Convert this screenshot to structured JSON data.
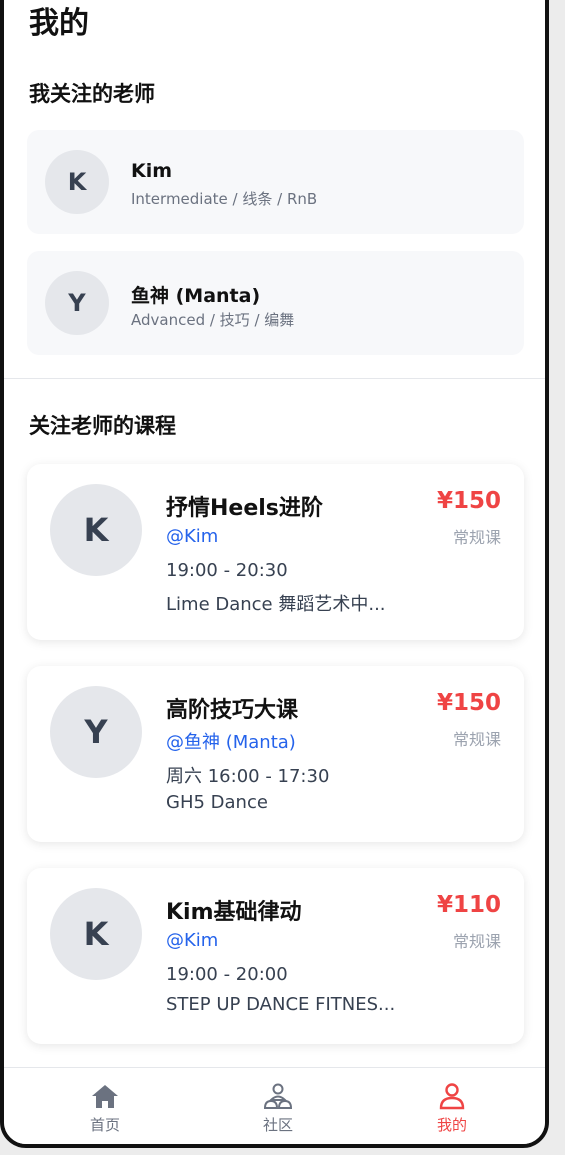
{
  "page": {
    "title": "我的"
  },
  "followed_teachers": {
    "section_title": "我关注的老师",
    "items": [
      {
        "initial": "K",
        "name": "Kim",
        "tags": "Intermediate / 线条 / RnB"
      },
      {
        "initial": "Y",
        "name": "鱼神 (Manta)",
        "tags": "Advanced / 技巧 / 编舞"
      }
    ]
  },
  "courses": {
    "section_title": "关注老师的课程",
    "items": [
      {
        "initial": "K",
        "title": "抒情Heels进阶",
        "teacher": "@Kim",
        "time": "19:00 - 20:30",
        "venue": "Lime Dance 舞蹈艺术中...",
        "price": "¥150",
        "type": "常规课"
      },
      {
        "initial": "Y",
        "title": "高阶技巧大课",
        "teacher": "@鱼神 (Manta)",
        "time": "周六 16:00 - 17:30",
        "venue": "GH5 Dance",
        "price": "¥150",
        "type": "常规课"
      },
      {
        "initial": "K",
        "title": "Kim基础律动",
        "teacher": "@Kim",
        "time": "19:00 - 20:00",
        "venue": "STEP UP DANCE FITNES...",
        "price": "¥110",
        "type": "常规课"
      }
    ]
  },
  "tabbar": {
    "items": [
      {
        "label": "首页",
        "icon": "home-icon",
        "active": false
      },
      {
        "label": "社区",
        "icon": "community-icon",
        "active": false
      },
      {
        "label": "我的",
        "icon": "profile-icon",
        "active": true
      }
    ]
  },
  "colors": {
    "accent": "#ef4444",
    "link": "#2563eb",
    "avatar_bg": "#e5e7eb"
  }
}
